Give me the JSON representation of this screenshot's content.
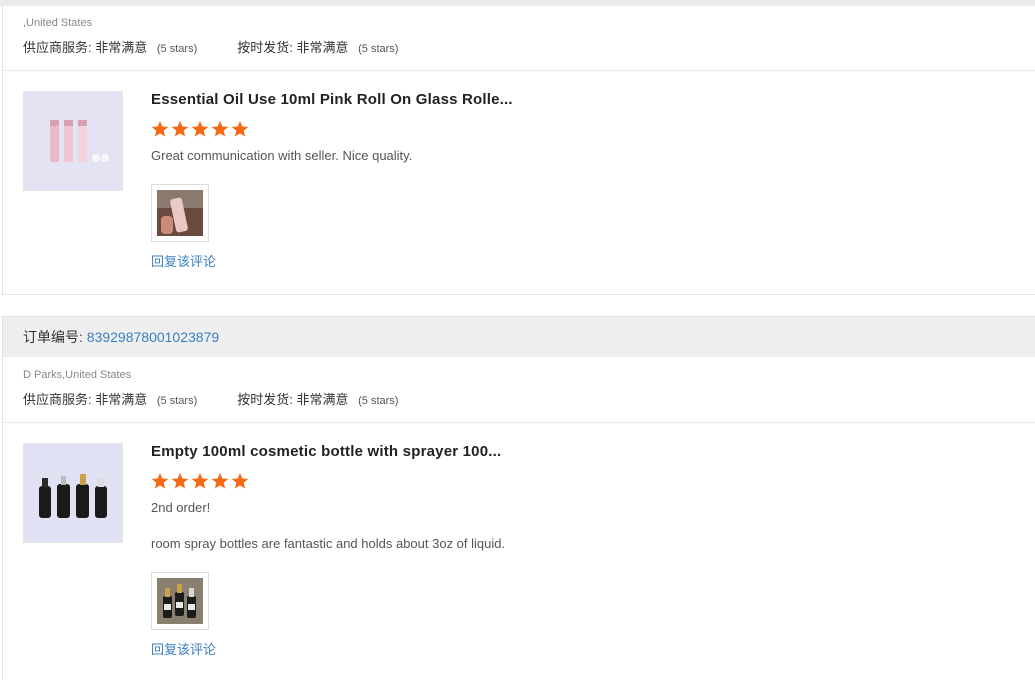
{
  "reviews": [
    {
      "buyer": ",United States",
      "supplier_service": {
        "label": "供应商服务:",
        "value": "非常满意",
        "stars_text": "(5 stars)"
      },
      "on_time": {
        "label": "按时发货:",
        "value": "非常满意",
        "stars_text": "(5 stars)"
      },
      "product_title": "Essential Oil Use 10ml Pink Roll On Glass Rolle...",
      "rating": 5,
      "comments": [
        "Great communication with seller. Nice quality."
      ],
      "reply_label": "回复该评论"
    },
    {
      "order_label": "订单编号:",
      "order_number": "83929878001023879",
      "buyer": "D Parks,United States",
      "supplier_service": {
        "label": "供应商服务:",
        "value": "非常满意",
        "stars_text": "(5 stars)"
      },
      "on_time": {
        "label": "按时发货:",
        "value": "非常满意",
        "stars_text": "(5 stars)"
      },
      "product_title": "Empty 100ml cosmetic bottle with sprayer 100...",
      "rating": 5,
      "comments": [
        "2nd order!",
        "room spray bottles are fantastic and holds about 3oz of liquid."
      ],
      "reply_label": "回复该评论"
    }
  ],
  "colors": {
    "star": "#f56a15",
    "link": "#3a7fc1",
    "order_bar": "#efefef"
  }
}
